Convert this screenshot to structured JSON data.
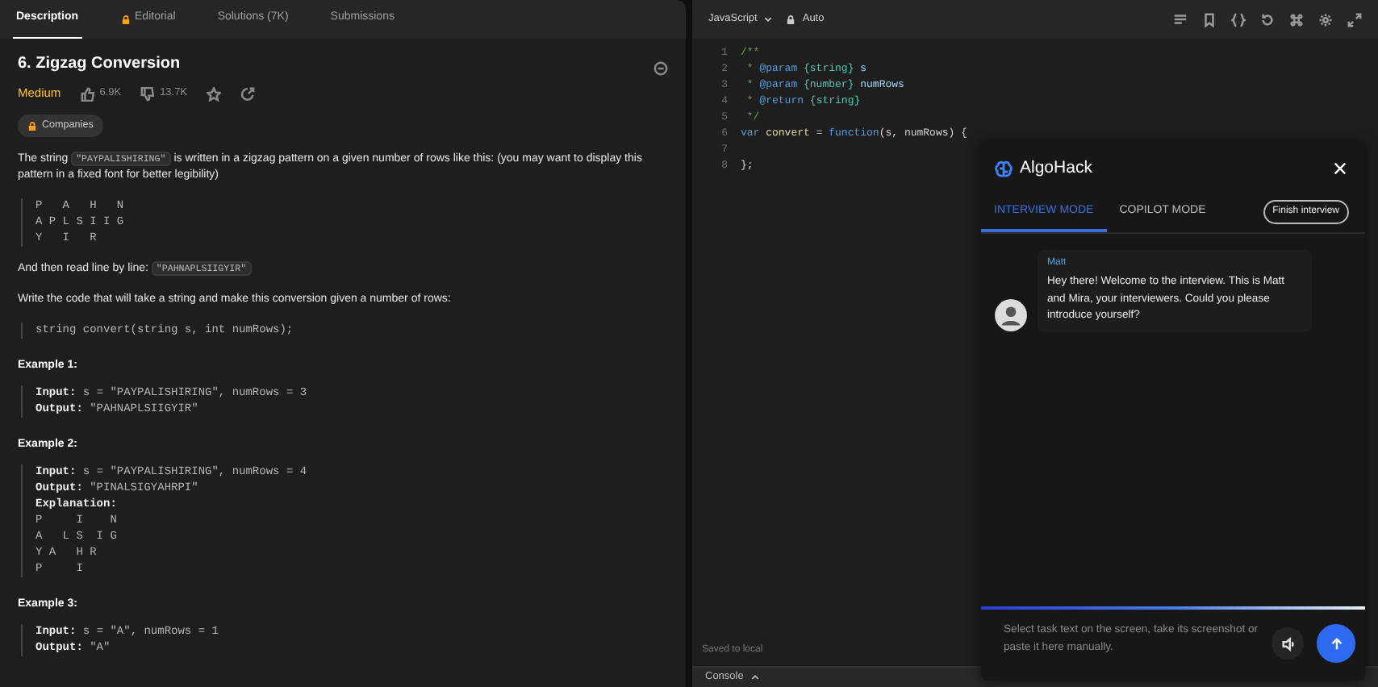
{
  "problem_tabs": [
    {
      "label": "Description",
      "selected": true,
      "locked": false
    },
    {
      "label": "Editorial",
      "selected": false,
      "locked": true
    },
    {
      "label": "Solutions (7K)",
      "selected": false,
      "locked": false
    },
    {
      "label": "Submissions",
      "selected": false,
      "locked": false
    }
  ],
  "problem": {
    "title": "6. Zigzag Conversion",
    "difficulty": "Medium",
    "likes": "6.9K",
    "dislikes": "13.7K",
    "tag": "Companies",
    "paragraphs": [
      {
        "kind": "text",
        "segments": [
          {
            "kind": "text",
            "text": "The string "
          },
          {
            "kind": "code",
            "text": "\"PAYPALISHIRING\""
          },
          {
            "kind": "text",
            "text": " is written in a zigzag pattern on a given number of rows like this: (you may want to display this pattern in a fixed font for better legibility)"
          }
        ]
      },
      {
        "kind": "block",
        "lines": [
          "P   A   H   N",
          "A P L S I I G",
          "Y   I   R"
        ]
      },
      {
        "kind": "text",
        "segments": [
          {
            "kind": "text",
            "text": "And then read line by line: "
          },
          {
            "kind": "code",
            "text": "\"PAHNAPLSIIGYIR\""
          }
        ]
      },
      {
        "kind": "text",
        "segments": [
          {
            "kind": "text",
            "text": "Write the code that will take a string and make this conversion given a number of rows:"
          }
        ]
      },
      {
        "kind": "block",
        "lines": [
          "string convert(string s, int numRows);"
        ]
      }
    ],
    "examples": [
      {
        "title": "Example 1:",
        "lines": [
          {
            "label": "Input:",
            "value": "s = \"PAYPALISHIRING\", numRows = 3"
          },
          {
            "label": "Output:",
            "value": "\"PAHNAPLSIIGYIR\""
          }
        ]
      },
      {
        "title": "Example 2:",
        "lines": [
          {
            "label": "Input:",
            "value": "s = \"PAYPALISHIRING\", numRows = 4"
          },
          {
            "label": "Output:",
            "value": "\"PINALSIGYAHRPI\""
          },
          {
            "label": "Explanation:"
          },
          {
            "value": "P     I    N"
          },
          {
            "value": "A   L S  I G"
          },
          {
            "value": "Y A   H R"
          },
          {
            "value": "P     I"
          }
        ]
      },
      {
        "title": "Example 3:",
        "lines": [
          {
            "label": "Input:",
            "value": "s = \"A\", numRows = 1"
          },
          {
            "label": "Output:",
            "value": "\"A\""
          }
        ]
      }
    ]
  },
  "editor": {
    "language": "JavaScript",
    "mode": "Auto",
    "lines": [
      {
        "number": "1",
        "segments": [
          {
            "kind": "comment",
            "text": "/**"
          }
        ]
      },
      {
        "number": "2",
        "segments": [
          {
            "kind": "comment",
            "text": " * "
          },
          {
            "kind": "tag",
            "text": "@param"
          },
          {
            "kind": "type",
            "text": " {string} "
          },
          {
            "kind": "name",
            "text": "s"
          }
        ]
      },
      {
        "number": "3",
        "segments": [
          {
            "kind": "comment",
            "text": " * "
          },
          {
            "kind": "tag",
            "text": "@param"
          },
          {
            "kind": "type",
            "text": " {number} "
          },
          {
            "kind": "name",
            "text": "numRows"
          }
        ]
      },
      {
        "number": "4",
        "segments": [
          {
            "kind": "comment",
            "text": " * "
          },
          {
            "kind": "tag",
            "text": "@return"
          },
          {
            "kind": "type",
            "text": " {string}"
          }
        ]
      },
      {
        "number": "5",
        "segments": [
          {
            "kind": "comment",
            "text": " */"
          }
        ]
      },
      {
        "number": "6",
        "segments": [
          {
            "kind": "keyword",
            "text": "var "
          },
          {
            "kind": "func",
            "text": "convert"
          },
          {
            "kind": "plain",
            "text": " = "
          },
          {
            "kind": "keyword",
            "text": "function"
          },
          {
            "kind": "plain",
            "text": "(s, numRows) {"
          }
        ]
      },
      {
        "number": "7"
      },
      {
        "number": "8",
        "segments": [
          {
            "kind": "plain",
            "text": "};"
          }
        ]
      }
    ],
    "status": "Saved to local",
    "console": "Console"
  },
  "assistant": {
    "title": "AlgoHack",
    "tabs": [
      {
        "label": "INTERVIEW MODE",
        "selected": true
      },
      {
        "label": "COPILOT MODE",
        "selected": false
      }
    ],
    "finish": "Finish interview",
    "messages": [
      {
        "sender": "Matt",
        "text": "Hey there! Welcome to the interview. This is Matt and Mira, your interviewers. Could you please introduce yourself?"
      }
    ],
    "input": {
      "placeholder": "Select task text on the screen, take its screenshot or paste it here manually."
    }
  }
}
